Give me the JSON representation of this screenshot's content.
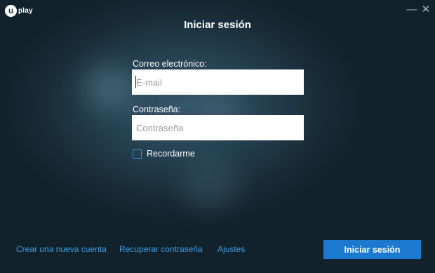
{
  "app": {
    "logo_letter": "u",
    "logo_text": "play",
    "minimize_glyph": "—",
    "close_glyph": "✕"
  },
  "page": {
    "title": "Iniciar sesión"
  },
  "form": {
    "email_label": "Correo electrónico:",
    "email_placeholder": "E-mail",
    "email_value": "",
    "password_label": "Contraseña:",
    "password_placeholder": "Contraseña",
    "password_value": "",
    "remember_label": "Recordarme",
    "remember_checked": false
  },
  "footer": {
    "create_account": "Crear una nueva cuenta",
    "recover_password": "Recuperar contraseña",
    "settings": "Ajustes",
    "login_button": "Iniciar sesión"
  },
  "colors": {
    "accent": "#1b7ad0",
    "link": "#3b9ae0",
    "background": "#1e3442"
  }
}
